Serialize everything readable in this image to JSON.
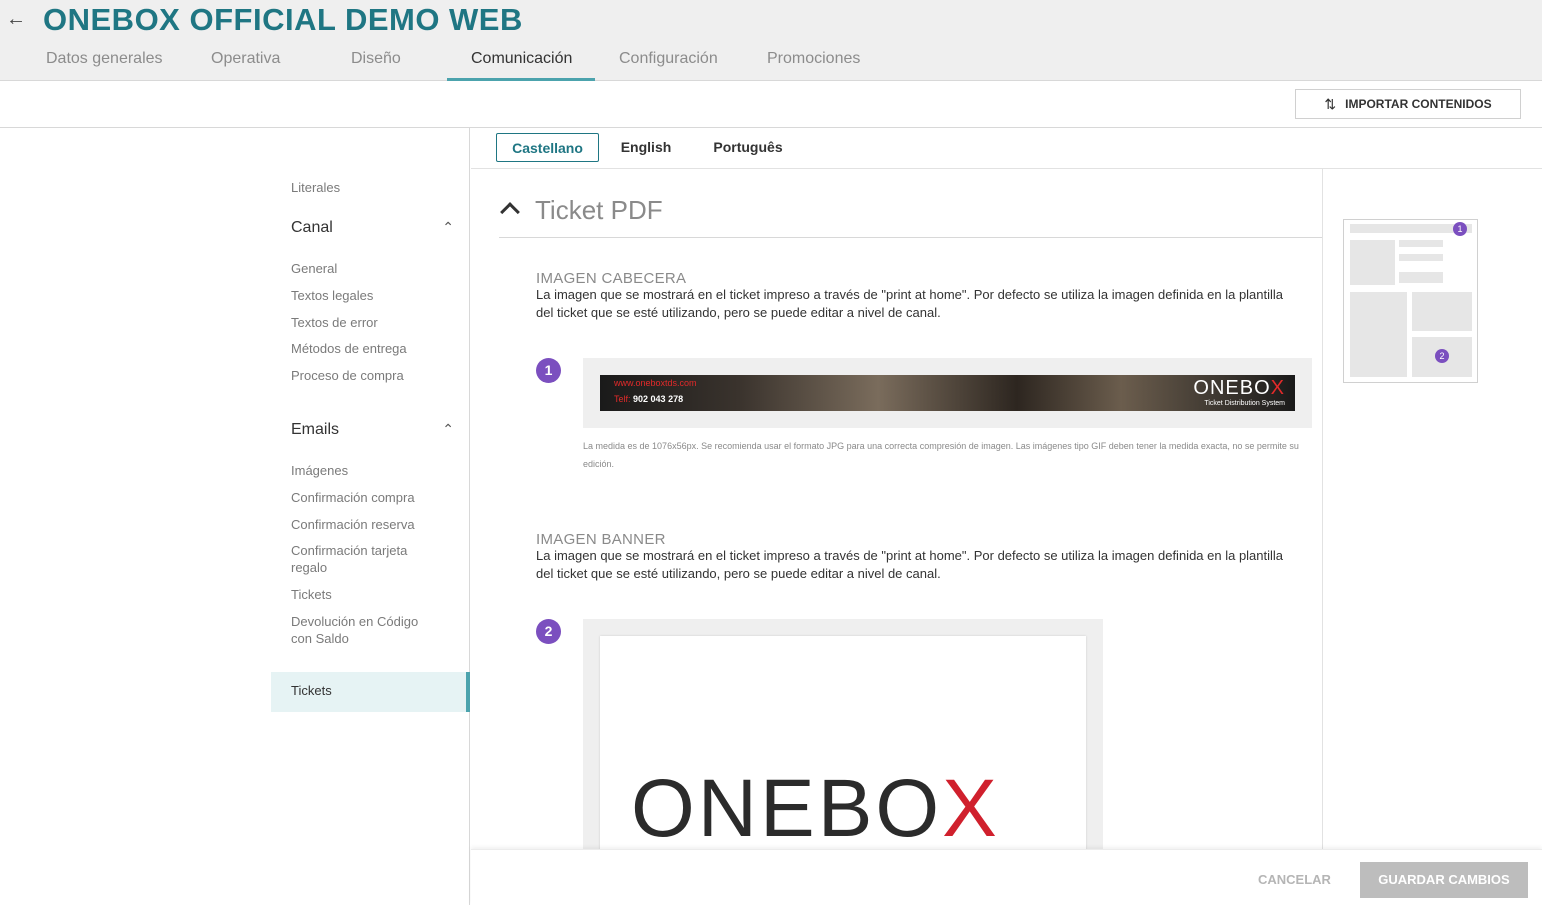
{
  "header": {
    "back_icon": "arrow-left-icon",
    "title": "ONEBOX OFFICIAL DEMO WEB",
    "tabs": [
      {
        "label": "Datos generales"
      },
      {
        "label": "Operativa"
      },
      {
        "label": "Diseño"
      },
      {
        "label": "Comunicación",
        "active": true
      },
      {
        "label": "Configuración"
      },
      {
        "label": "Promociones"
      }
    ]
  },
  "toolbar": {
    "import_label": "IMPORTAR CONTENIDOS",
    "import_icon": "swap-vertical-icon"
  },
  "sidebar": {
    "literales": "Literales",
    "canal": {
      "label": "Canal",
      "items": [
        "General",
        "Textos legales",
        "Textos de error",
        "Métodos de entrega",
        "Proceso de compra"
      ]
    },
    "emails": {
      "label": "Emails",
      "items": [
        "Imágenes",
        "Confirmación compra",
        "Confirmación reserva",
        "Confirmación tarjeta regalo",
        "Tickets",
        "Devolución en Código con Saldo"
      ]
    },
    "active_item": "Tickets"
  },
  "languages": [
    "Castellano",
    "English",
    "Português"
  ],
  "active_language": "Castellano",
  "section": {
    "title": "Ticket PDF",
    "fields": [
      {
        "badge": "1",
        "title": "Imagen cabecera",
        "description": "La imagen que se mostrará en el ticket impreso a través de \"print at home\". Por defecto se utiliza la imagen definida en la plantilla del ticket que se esté utilizando, pero se puede editar a nivel de canal.",
        "hint": "La medida es de 1076x56px. Se recomienda usar el formato JPG para una correcta compresión de imagen. Las imágenes tipo GIF deben tener la medida exacta, no se permite su edición.",
        "image": {
          "web": "www.oneboxtds.com",
          "tel_label": "Telf:",
          "tel": "902 043 278",
          "brand_main": "ONEBO",
          "brand_x": "X",
          "brand_sub": "Ticket Distribution System"
        }
      },
      {
        "badge": "2",
        "title": "Imagen banner",
        "description": "La imagen que se mostrará en el ticket impreso a través de \"print at home\". Por defecto se utiliza la imagen definida en la plantilla del ticket que se esté utilizando, pero se puede editar a nivel de canal.",
        "image": {
          "brand_main": "ONEBO",
          "brand_x": "X"
        }
      }
    ]
  },
  "preview": {
    "badge1": "1",
    "badge2": "2"
  },
  "footer": {
    "cancel": "CANCELAR",
    "save": "GUARDAR CAMBIOS"
  },
  "colors": {
    "accent": "#1f7683",
    "tab_underline": "#4ca3ad",
    "badge": "#7b4fbf",
    "logo_x": "#d0202d"
  }
}
